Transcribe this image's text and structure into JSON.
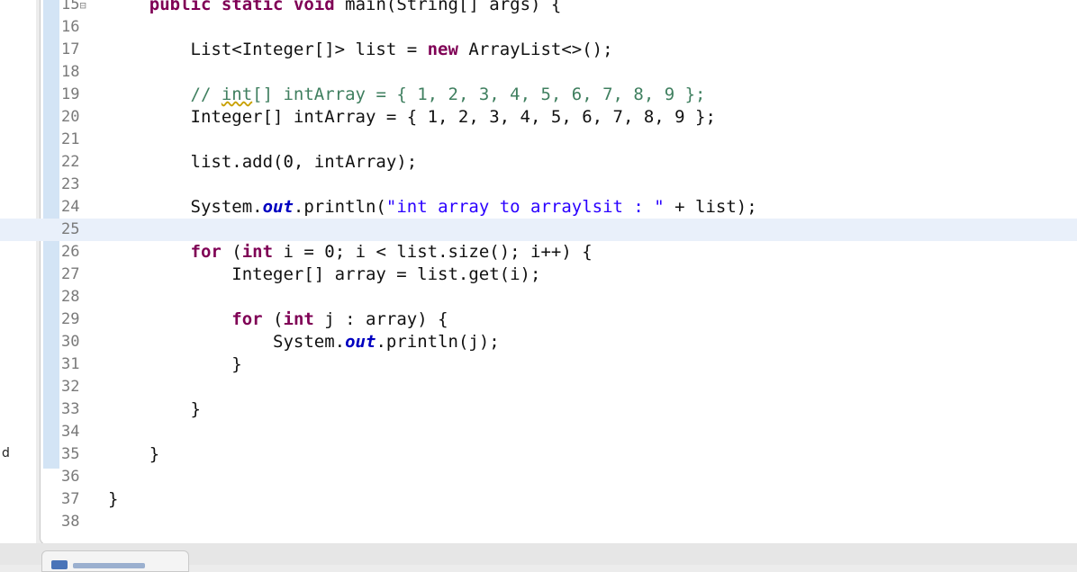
{
  "left_panel": {
    "text": "d"
  },
  "editor": {
    "lines": [
      {
        "num": "15",
        "fold": true,
        "code": "    public static void main(String[] args) {"
      },
      {
        "num": "16",
        "code": ""
      },
      {
        "num": "17",
        "code": "        List<Integer[]> list = new ArrayList<>();"
      },
      {
        "num": "18",
        "code": ""
      },
      {
        "num": "19",
        "code": "        // int[] intArray = { 1, 2, 3, 4, 5, 6, 7, 8, 9 };"
      },
      {
        "num": "20",
        "code": "        Integer[] intArray = { 1, 2, 3, 4, 5, 6, 7, 8, 9 };"
      },
      {
        "num": "21",
        "code": ""
      },
      {
        "num": "22",
        "code": "        list.add(0, intArray);"
      },
      {
        "num": "23",
        "code": ""
      },
      {
        "num": "24",
        "code": "        System.out.println(\"int array to arraylsit : \" + list);"
      },
      {
        "num": "25",
        "code": "",
        "current": true
      },
      {
        "num": "26",
        "code": "        for (int i = 0; i < list.size(); i++) {"
      },
      {
        "num": "27",
        "code": "            Integer[] array = list.get(i);"
      },
      {
        "num": "28",
        "code": ""
      },
      {
        "num": "29",
        "code": "            for (int j : array) {"
      },
      {
        "num": "30",
        "code": "                System.out.println(j);"
      },
      {
        "num": "31",
        "code": "            }"
      },
      {
        "num": "32",
        "code": ""
      },
      {
        "num": "33",
        "code": "        }"
      },
      {
        "num": "34",
        "code": ""
      },
      {
        "num": "35",
        "code": "    }"
      },
      {
        "num": "36",
        "code": ""
      },
      {
        "num": "37",
        "code": "}"
      },
      {
        "num": "38",
        "code": ""
      }
    ]
  },
  "colors": {
    "keyword": "#7f0055",
    "comment": "#3f7f5f",
    "string": "#2a00ff",
    "static_field": "#0000c0",
    "current_line": "#e9f0fa",
    "gutter_highlight": "#d3e4f5"
  }
}
